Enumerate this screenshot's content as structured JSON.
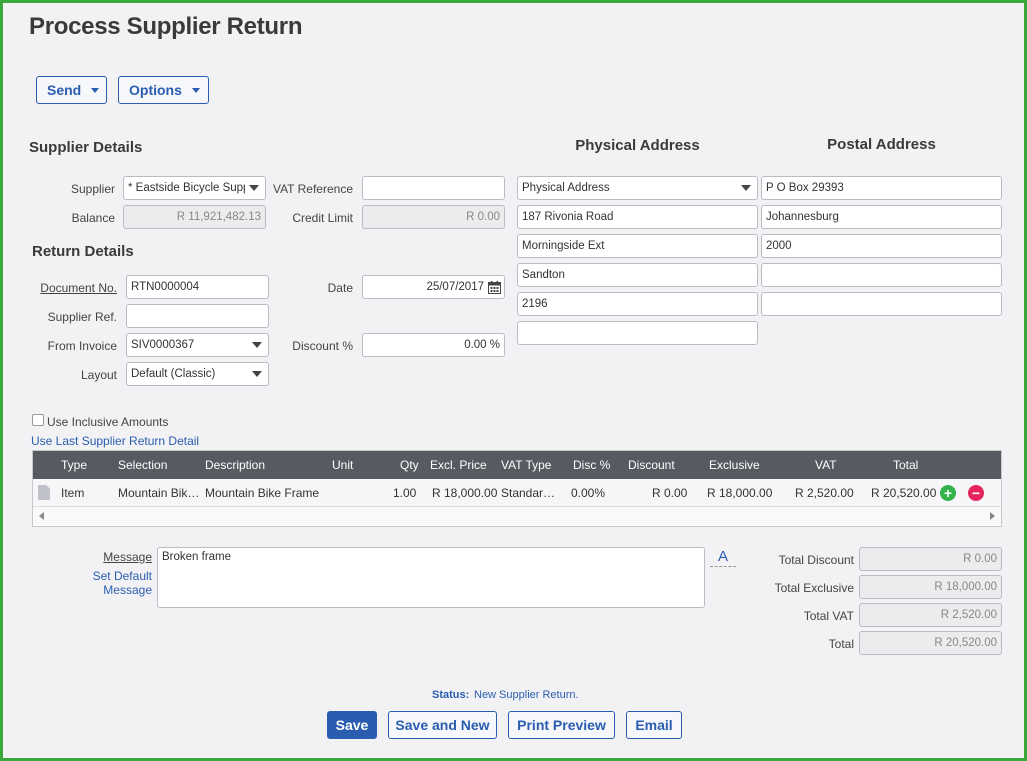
{
  "page": {
    "title": "Process Supplier Return"
  },
  "toolbar": {
    "send_label": "Send",
    "options_label": "Options"
  },
  "supplier_details": {
    "heading": "Supplier Details",
    "supplier_label": "Supplier",
    "supplier_value": "* Eastside Bicycle Supplie",
    "balance_label": "Balance",
    "balance_value": "R 11,921,482.13",
    "vat_ref_label": "VAT Reference",
    "vat_ref_value": "",
    "credit_limit_label": "Credit Limit",
    "credit_limit_value": "R 0.00"
  },
  "return_details": {
    "heading": "Return Details",
    "doc_no_label": "Document No.",
    "doc_no_value": "RTN0000004",
    "supplier_ref_label": "Supplier Ref.",
    "supplier_ref_value": "",
    "from_invoice_label": "From Invoice",
    "from_invoice_value": "SIV0000367",
    "layout_label": "Layout",
    "layout_value": "Default (Classic)",
    "date_label": "Date",
    "date_value": "25/07/2017",
    "discount_label": "Discount %",
    "discount_value": "0.00 %"
  },
  "physical_address": {
    "heading": "Physical Address",
    "type_value": "Physical Address",
    "lines": [
      "187 Rivonia Road",
      "Morningside Ext",
      "Sandton",
      "2196",
      ""
    ]
  },
  "postal_address": {
    "heading": "Postal Address",
    "lines": [
      "P O Box 29393",
      "Johannesburg",
      "2000",
      "",
      ""
    ]
  },
  "options": {
    "inclusive_label": "Use Inclusive Amounts",
    "last_detail_link": "Use Last Supplier Return Detail"
  },
  "grid": {
    "columns": [
      "Type",
      "Selection",
      "Description",
      "Unit",
      "Qty",
      "Excl. Price",
      "VAT Type",
      "Disc %",
      "Discount",
      "Exclusive",
      "VAT",
      "Total"
    ],
    "rows": [
      {
        "type": "Item",
        "selection": "Mountain Bik…",
        "description": "Mountain Bike Frame",
        "unit": "",
        "qty": "1.00",
        "excl_price": "R 18,000.00",
        "vat_type": "Standar…",
        "disc_pct": "0.00%",
        "discount": "R 0.00",
        "exclusive": "R 18,000.00",
        "vat": "R 2,520.00",
        "total": "R 20,520.00"
      }
    ]
  },
  "message": {
    "label": "Message",
    "set_default_link": "Set Default Message",
    "value": "Broken frame",
    "font_button": "A"
  },
  "totals": {
    "discount_label": "Total Discount",
    "discount_value": "R 0.00",
    "exclusive_label": "Total Exclusive",
    "exclusive_value": "R 18,000.00",
    "vat_label": "Total VAT",
    "vat_value": "R 2,520.00",
    "total_label": "Total",
    "total_value": "R 20,520.00"
  },
  "status": {
    "label": "Status:",
    "value": "New Supplier Return."
  },
  "actions": {
    "save": "Save",
    "save_new": "Save and New",
    "print_preview": "Print Preview",
    "email": "Email"
  },
  "colors": {
    "accent": "#2a5db0",
    "frame": "#3ba83b",
    "grid_header": "#575a61",
    "add": "#33b34a",
    "remove": "#e5245e"
  },
  "icons": {
    "calendar": "calendar-icon",
    "add": "plus-circle-icon",
    "remove": "minus-circle-icon",
    "row_type": "document-icon"
  }
}
